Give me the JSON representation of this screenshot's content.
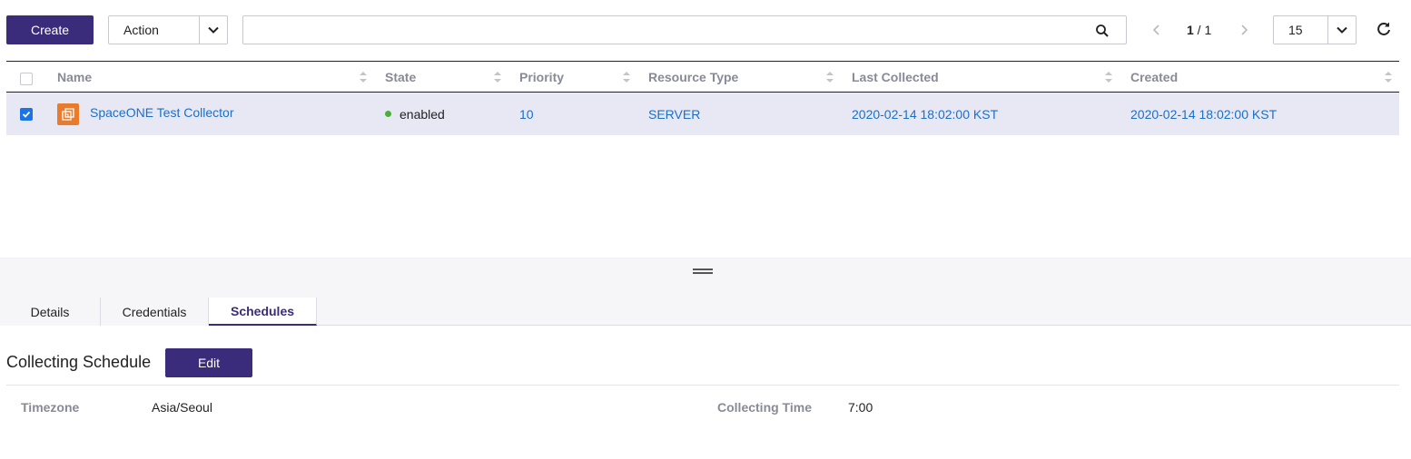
{
  "toolbar": {
    "create_label": "Create",
    "action_label": "Action",
    "search_value": "",
    "search_placeholder": "",
    "pagination": {
      "current": "1",
      "separator": " / ",
      "total": "1"
    },
    "page_size": "15"
  },
  "table": {
    "columns": [
      {
        "label": "Name"
      },
      {
        "label": "State"
      },
      {
        "label": "Priority"
      },
      {
        "label": "Resource Type"
      },
      {
        "label": "Last Collected"
      },
      {
        "label": "Created"
      }
    ],
    "rows": [
      {
        "selected": true,
        "name": "SpaceONE Test Collector",
        "state": "enabled",
        "priority": "10",
        "resource_type": "SERVER",
        "last_collected": "2020-02-14 18:02:00 KST",
        "created": "2020-02-14 18:02:00 KST"
      }
    ]
  },
  "tabs": [
    {
      "label": "Details",
      "active": false
    },
    {
      "label": "Credentials",
      "active": false
    },
    {
      "label": "Schedules",
      "active": true
    }
  ],
  "schedule": {
    "title": "Collecting Schedule",
    "edit_label": "Edit",
    "timezone_label": "Timezone",
    "timezone_value": "Asia/Seoul",
    "time_label": "Collecting Time",
    "time_value": "7:00"
  },
  "colors": {
    "primary": "#3a2c7a",
    "link": "#1a6fc9",
    "selected_row": "#e8e8f4",
    "enabled_dot": "#4cae3c",
    "collector_icon": "#e87c2c"
  }
}
